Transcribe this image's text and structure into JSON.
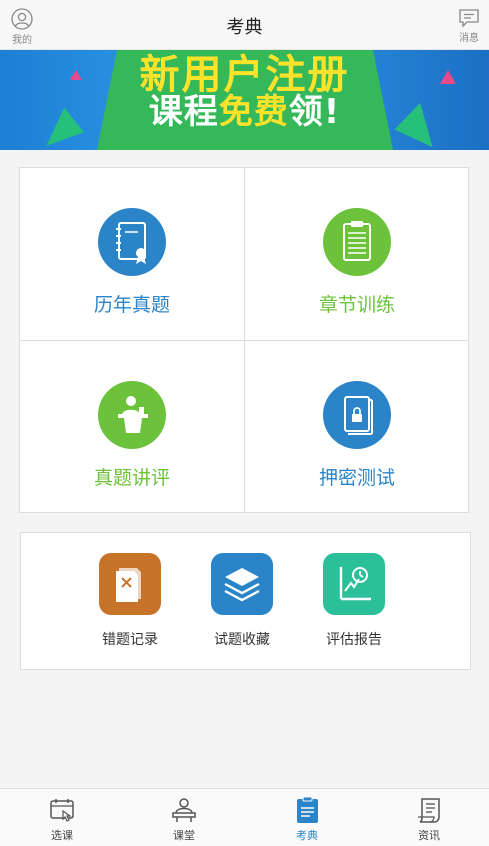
{
  "header": {
    "title": "考典",
    "left_label": "我的",
    "right_label": "消息"
  },
  "banner": {
    "line1": "新用户注册",
    "line2_a": "课程",
    "line2_b": "免费",
    "line2_c": "领!"
  },
  "grid": [
    {
      "label": "历年真题",
      "icon": "book-certificate-icon",
      "color": "#2b84c8"
    },
    {
      "label": "章节训练",
      "icon": "clipboard-list-icon",
      "color": "#6cc23b"
    },
    {
      "label": "真题讲评",
      "icon": "lecturer-podium-icon",
      "color": "#6cc23b"
    },
    {
      "label": "押密测试",
      "icon": "locked-book-icon",
      "color": "#2b84c8"
    }
  ],
  "tools": [
    {
      "label": "错题记录",
      "icon": "wrong-notes-icon",
      "color": "#c8732a"
    },
    {
      "label": "试题收藏",
      "icon": "layers-icon",
      "color": "#2b84c8"
    },
    {
      "label": "评估报告",
      "icon": "report-chart-icon",
      "color": "#2bbf9a"
    }
  ],
  "nav": [
    {
      "label": "选课",
      "icon": "calendar-pointer-icon"
    },
    {
      "label": "课堂",
      "icon": "classroom-icon"
    },
    {
      "label": "考典",
      "icon": "exam-book-icon",
      "active": true
    },
    {
      "label": "资讯",
      "icon": "news-scroll-icon"
    }
  ]
}
